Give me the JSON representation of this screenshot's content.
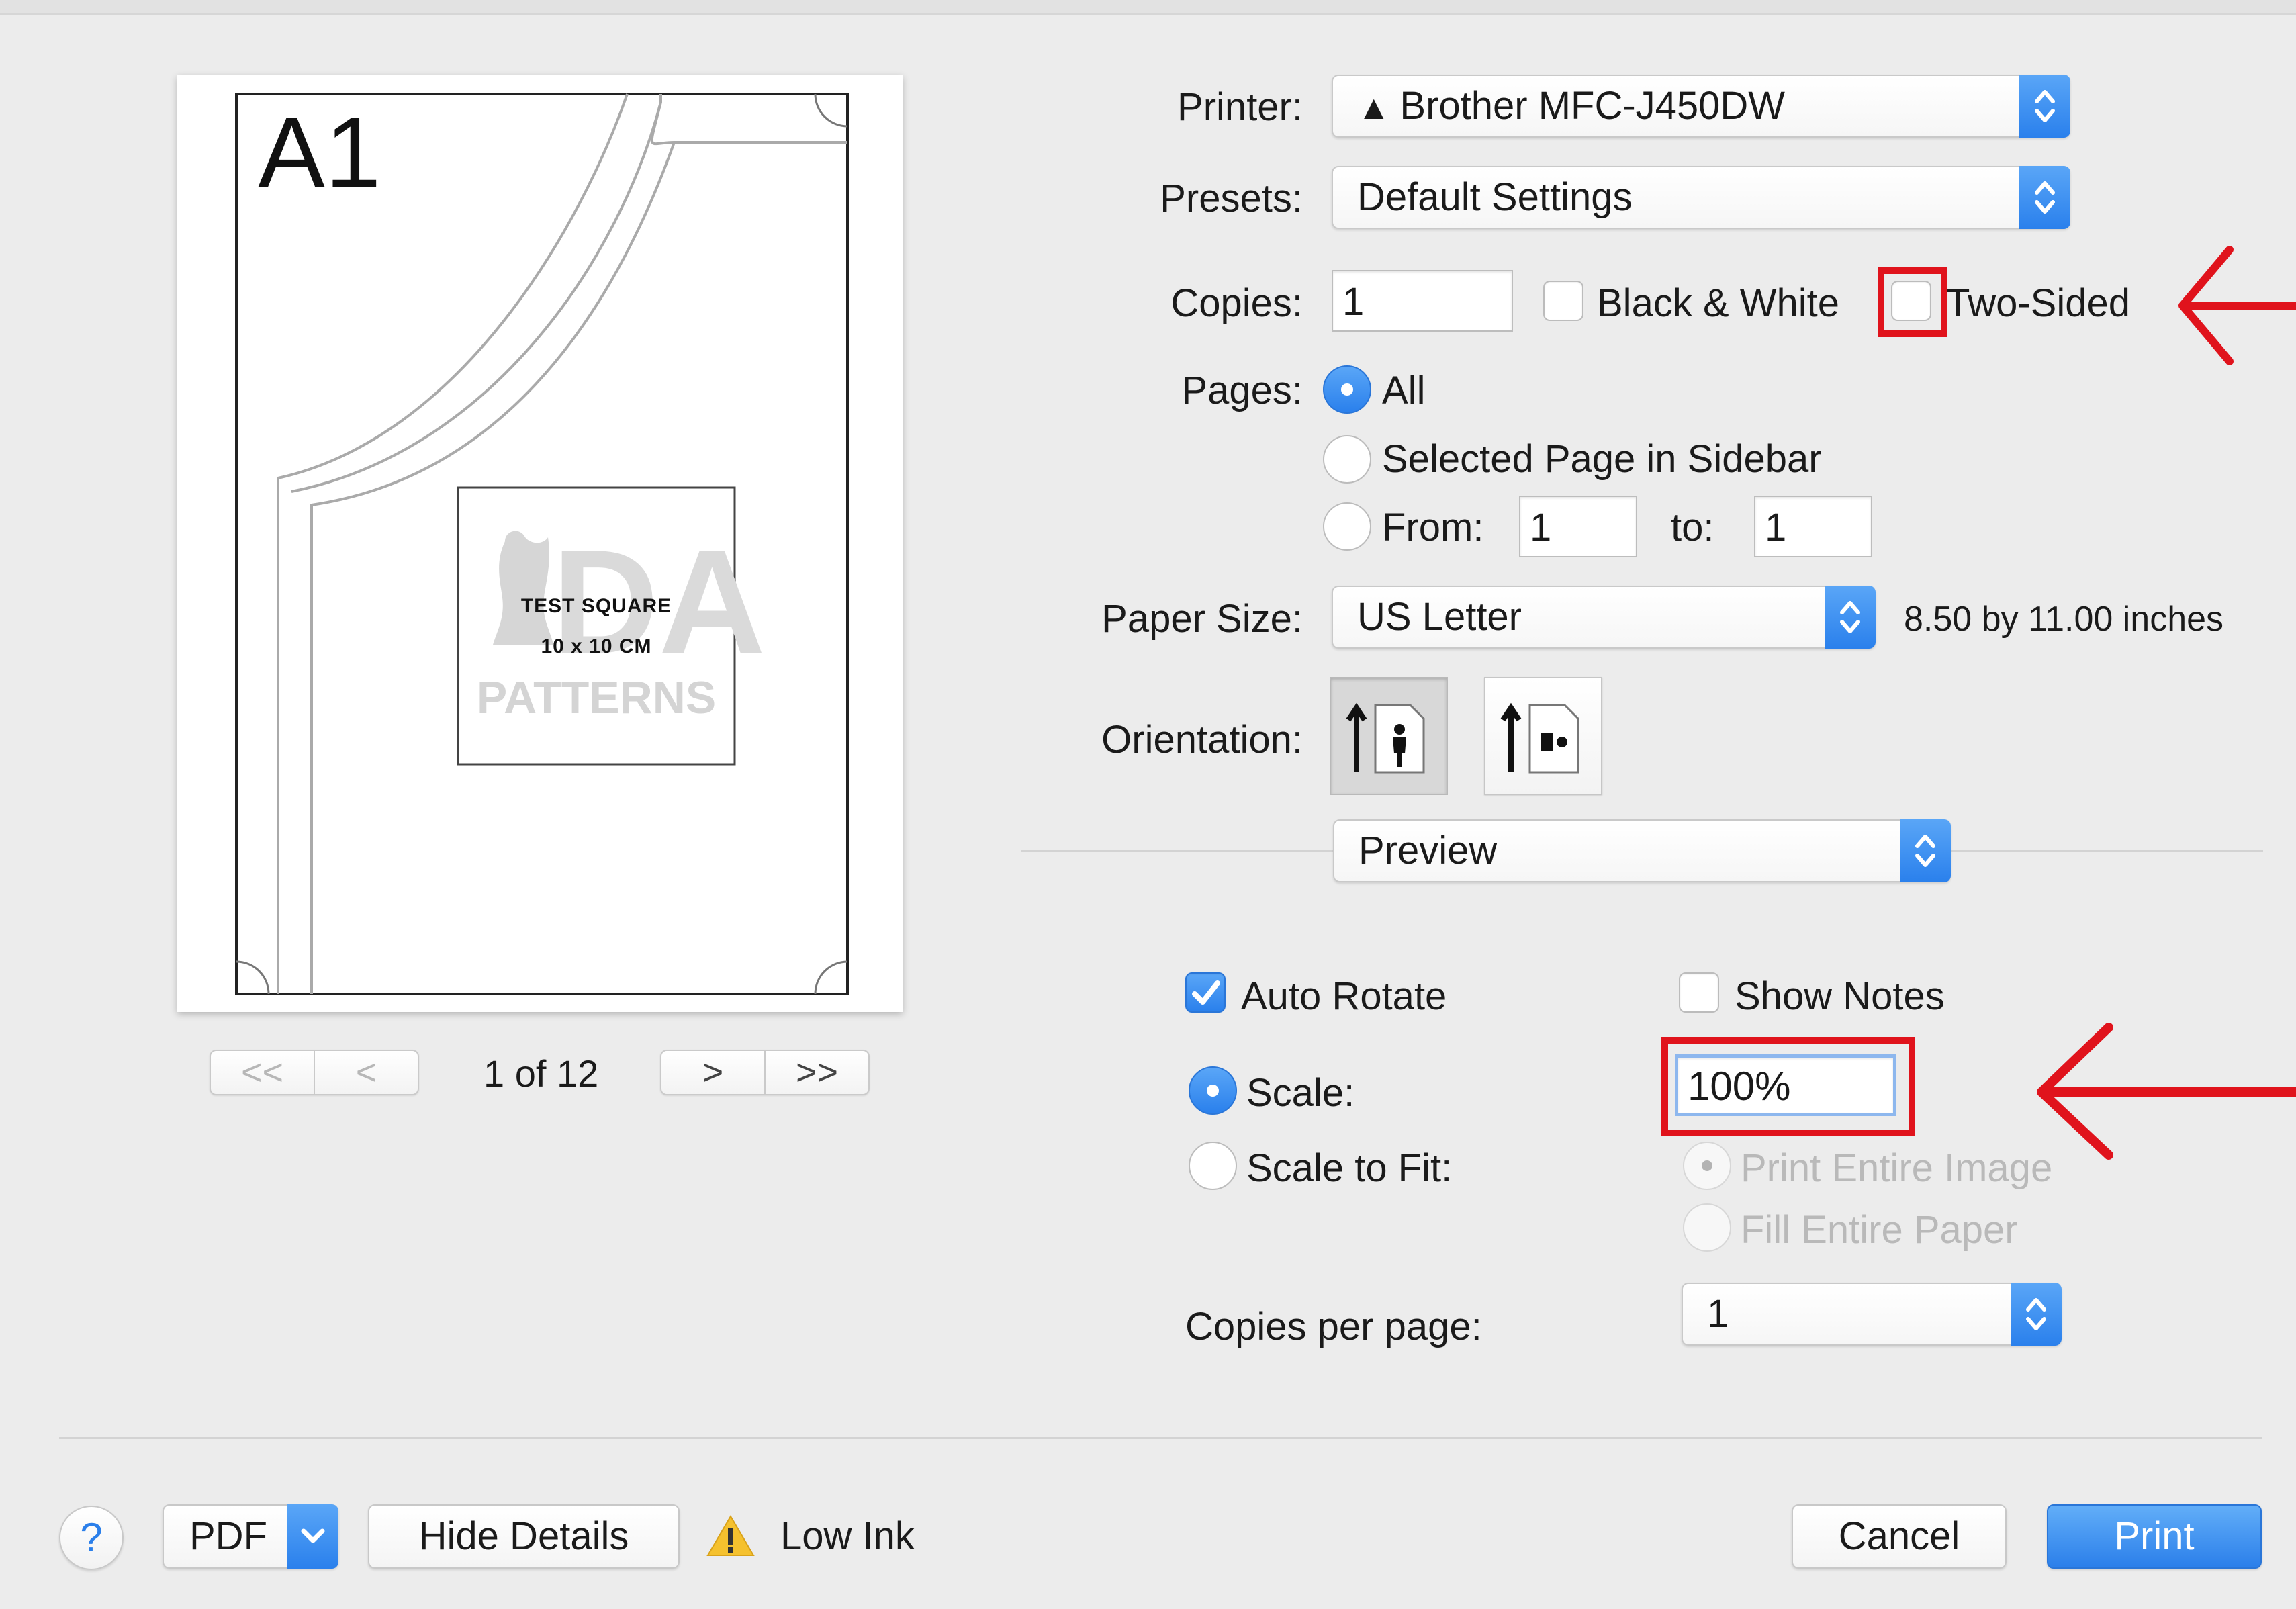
{
  "printer": {
    "label": "Printer:",
    "value": "Brother MFC-J450DW"
  },
  "presets": {
    "label": "Presets:",
    "value": "Default Settings"
  },
  "copies": {
    "label": "Copies:",
    "value": "1",
    "bw_label": "Black & White",
    "two_sided_label": "Two-Sided",
    "bw_checked": false,
    "two_sided_checked": false
  },
  "pages": {
    "label": "Pages:",
    "all": "All",
    "selected": "Selected Page in Sidebar",
    "from_label": "From:",
    "from_value": "1",
    "to_label": "to:",
    "to_value": "1"
  },
  "paper": {
    "label": "Paper Size:",
    "value": "US Letter",
    "dimensions": "8.50 by 11.00 inches"
  },
  "orientation": {
    "label": "Orientation:",
    "selected": "portrait"
  },
  "section_popup": {
    "value": "Preview"
  },
  "preview_options": {
    "auto_rotate": "Auto Rotate",
    "auto_rotate_checked": true,
    "show_notes": "Show Notes",
    "show_notes_checked": false,
    "scale_label": "Scale:",
    "scale_value": "100%",
    "scale_to_fit_label": "Scale to Fit:",
    "print_entire_image": "Print Entire Image",
    "fill_entire_paper": "Fill Entire Paper",
    "copies_per_page_label": "Copies per page:",
    "copies_per_page_value": "1"
  },
  "preview": {
    "page_title": "A1",
    "test_square_line1": "TEST SQUARE",
    "test_square_line2": "10 x 10 CM",
    "watermark": "PATTERNS",
    "watermark_logo": "DA",
    "nav_first": "<<",
    "nav_prev": "<",
    "nav_next": ">",
    "nav_last": ">>",
    "page_indicator": "1 of 12"
  },
  "footer": {
    "help": "?",
    "pdf": "PDF",
    "hide_details": "Hide Details",
    "low_ink": "Low Ink",
    "cancel": "Cancel",
    "print": "Print"
  },
  "colors": {
    "accent": "#2b7fea",
    "highlight": "#e0131c"
  }
}
